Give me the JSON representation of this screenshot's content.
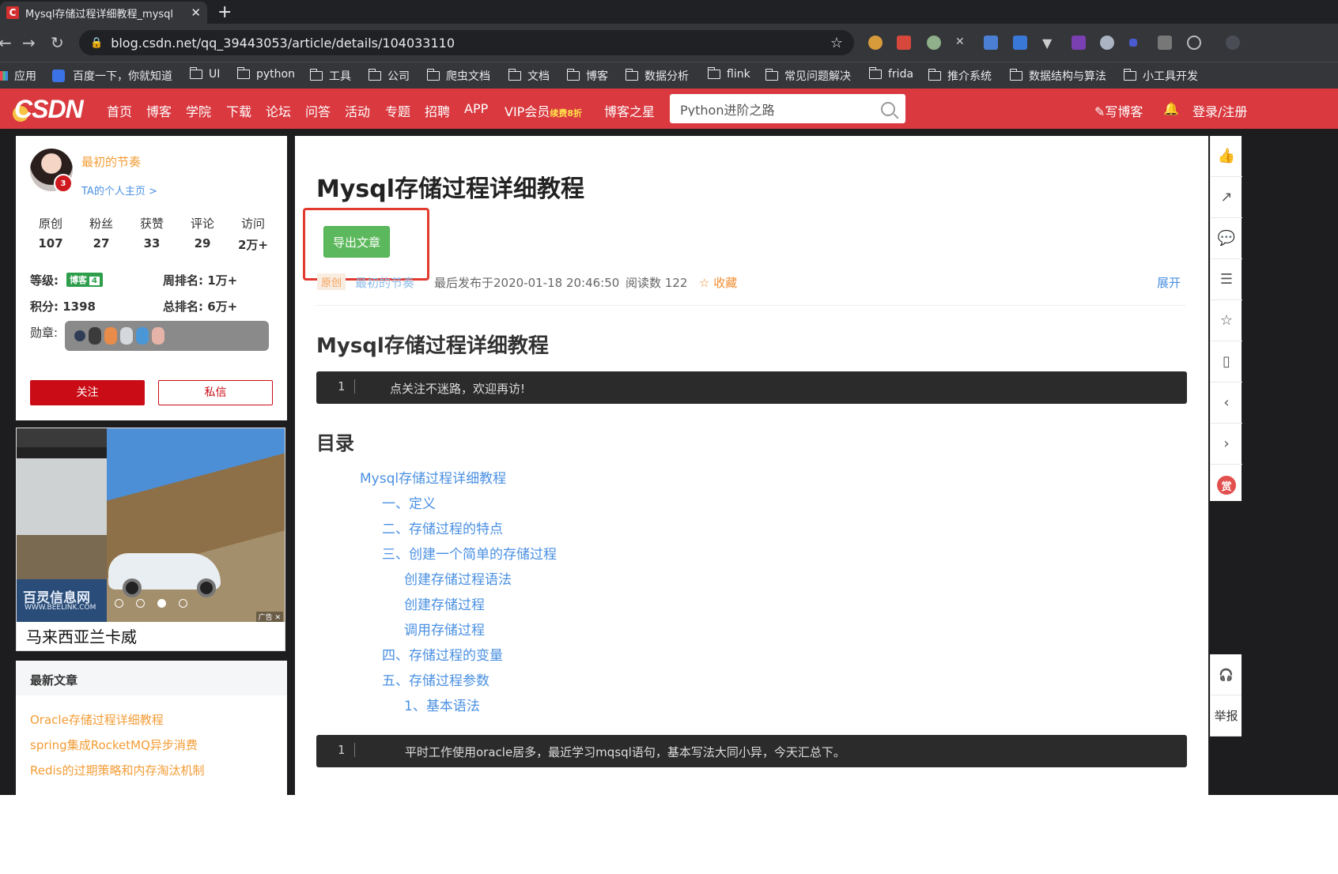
{
  "browser": {
    "tab_title": "Mysql存储过程详细教程_mysql",
    "tab_favicon": "C",
    "url": "blog.csdn.net/qq_39443053/article/details/104033110",
    "bookmarks": [
      "应用",
      "百度一下，你就知道",
      "UI",
      "python",
      "工具",
      "公司",
      "爬虫文档",
      "文档",
      "博客",
      "数据分析",
      "flink",
      "常见问题解决",
      "frida",
      "推介系统",
      "数据结构与算法",
      "小工具开发"
    ]
  },
  "header": {
    "logo": "CSDN",
    "nav": [
      "首页",
      "博客",
      "学院",
      "下载",
      "论坛",
      "问答",
      "活动",
      "专题",
      "招聘",
      "APP",
      "VIP会员",
      "博客之星"
    ],
    "vip_sub": "续费8折",
    "search_value": "Python进阶之路",
    "write_blog": "写博客",
    "login": "登录/注册"
  },
  "profile": {
    "name": "最初的节奏",
    "years": "3",
    "home_link": "TA的个人主页 >",
    "stats": [
      {
        "label": "原创",
        "value": "107"
      },
      {
        "label": "粉丝",
        "value": "27"
      },
      {
        "label": "获赞",
        "value": "33"
      },
      {
        "label": "评论",
        "value": "29"
      },
      {
        "label": "访问",
        "value": "2万+"
      }
    ],
    "level_label": "等级:",
    "level_badge": "博客",
    "level_num": "4",
    "week_rank": "周排名: 1万+",
    "points": "积分: 1398",
    "total_rank": "总排名: 6万+",
    "medals_label": "勋章:",
    "follow": "关注",
    "message": "私信"
  },
  "ad": {
    "brand": "百灵信息网",
    "brand_url": "WWW.BEELINK.COM",
    "caption": "马来西亚兰卡威",
    "tag": "广告"
  },
  "latest": {
    "title": "最新文章",
    "items": [
      "Oracle存储过程详细教程",
      "spring集成RocketMQ异步消费",
      "Redis的过期策略和内存淘汰机制"
    ]
  },
  "article": {
    "title": "Mysql存储过程详细教程",
    "export_button": "导出文章",
    "tag": "原创",
    "author": "最初的节奏",
    "published": "最后发布于2020-01-18 20:46:50",
    "reads": "阅读数 122",
    "favorite": "☆ 收藏",
    "expand": "展开",
    "heading": "Mysql存储过程详细教程",
    "code1_line": "1",
    "code1_text": "点关注不迷路，欢迎再访!",
    "toc_title": "目录",
    "toc": [
      "Mysql存储过程详细教程",
      "一、定义",
      "二、存储过程的特点",
      "三、创建一个简单的存储过程",
      "创建存储过程语法",
      "创建存储过程",
      "调用存储过程",
      "四、存储过程的变量",
      "五、存储过程参数",
      "1、基本语法"
    ],
    "code2_line": "1",
    "code2_text": "平时工作使用oracle居多，最近学习mqsql语句，基本写法大同小异，今天汇总下。"
  },
  "rail": {
    "reward": "赏",
    "report": "举报"
  }
}
